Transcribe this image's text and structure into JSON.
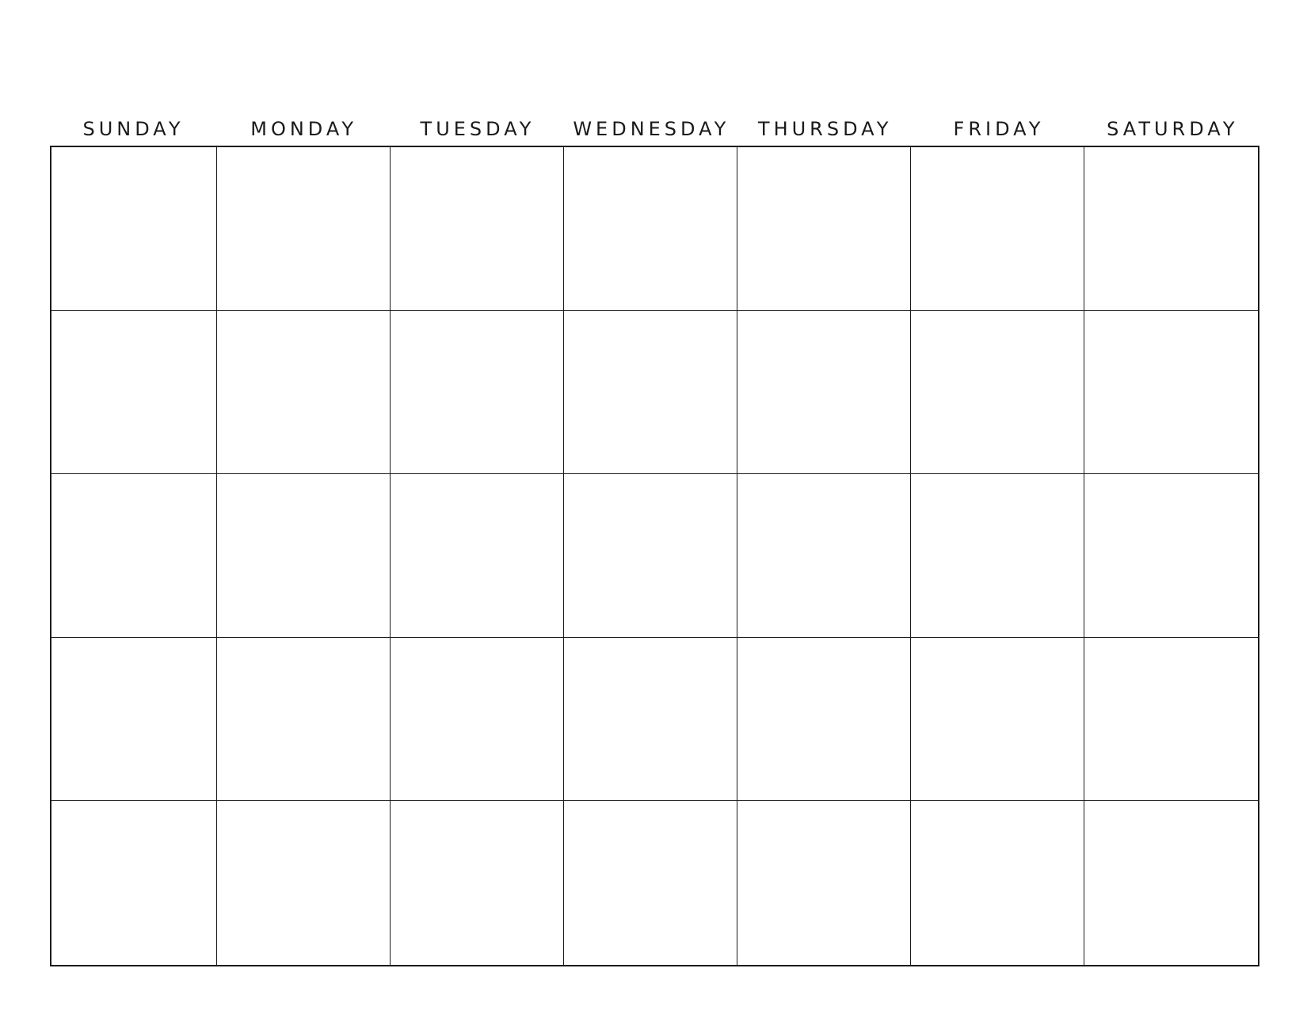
{
  "calendar": {
    "weekdays": [
      "SUNDAY",
      "MONDAY",
      "TUESDAY",
      "WEDNESDAY",
      "THURSDAY",
      "FRIDAY",
      "SATURDAY"
    ],
    "weeks": 5,
    "colors": {
      "line": "#1a1a1a",
      "background": "#ffffff"
    }
  }
}
